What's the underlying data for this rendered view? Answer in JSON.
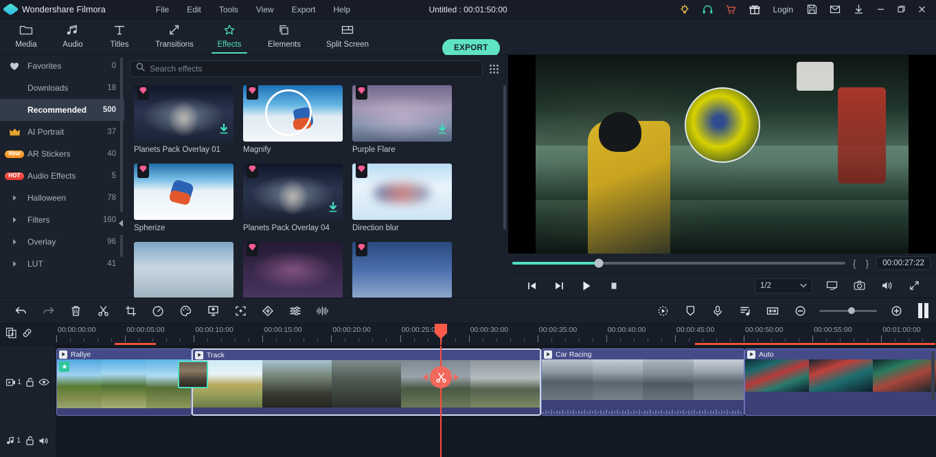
{
  "titlebar": {
    "app_name": "Wondershare Filmora",
    "logo_icon": "filmora-diamond-logo",
    "menus": [
      "File",
      "Edit",
      "Tools",
      "View",
      "Export",
      "Help"
    ],
    "project_title": "Untitled : 00:01:50:00",
    "icons": [
      {
        "name": "tips-bulb-icon",
        "glyph": "bulb",
        "color": "#f2c14e"
      },
      {
        "name": "support-headset-icon",
        "glyph": "headset",
        "color": "#3ecfb0"
      },
      {
        "name": "shopping-cart-icon",
        "glyph": "cart",
        "color": "#e05a4a"
      },
      {
        "name": "gift-icon",
        "glyph": "gift",
        "color": "#e7ebf1"
      }
    ],
    "login_label": "Login",
    "right_icons": [
      {
        "name": "save-icon",
        "glyph": "floppy"
      },
      {
        "name": "mail-icon",
        "glyph": "envelope"
      },
      {
        "name": "download-icon",
        "glyph": "download"
      }
    ],
    "window_buttons": [
      {
        "name": "minimize-button",
        "glyph": "minimize"
      },
      {
        "name": "maximize-button",
        "glyph": "maximize"
      },
      {
        "name": "close-button",
        "glyph": "close"
      }
    ]
  },
  "toolbar": {
    "tabs": [
      {
        "label": "Media",
        "icon": "folder-icon",
        "active": false
      },
      {
        "label": "Audio",
        "icon": "music-note-icon",
        "active": false
      },
      {
        "label": "Titles",
        "icon": "text-t-icon",
        "active": false
      },
      {
        "label": "Transitions",
        "icon": "transition-arrows-icon",
        "active": false
      },
      {
        "label": "Effects",
        "icon": "sparkle-star-icon",
        "active": true
      },
      {
        "label": "Elements",
        "icon": "layers-icon",
        "active": false
      },
      {
        "label": "Split Screen",
        "icon": "split-screen-icon",
        "active": false
      }
    ],
    "export_label": "EXPORT",
    "accent_color": "#4fe0c2",
    "export_bg": "#5fe3c4"
  },
  "sidebar": {
    "categories": [
      {
        "label": "Favorites",
        "count": "0",
        "icon": "heart-icon",
        "badge": null,
        "selected": false,
        "expandable": false
      },
      {
        "label": "Downloads",
        "count": "18",
        "icon": null,
        "badge": null,
        "selected": false,
        "expandable": false
      },
      {
        "label": "Recommended",
        "count": "500",
        "icon": null,
        "badge": null,
        "selected": true,
        "expandable": false
      },
      {
        "label": "AI Portrait",
        "count": "37",
        "icon": "crown-icon",
        "badge": null,
        "selected": false,
        "expandable": false
      },
      {
        "label": "AR Stickers",
        "count": "40",
        "icon": null,
        "badge": "New",
        "selected": false,
        "expandable": false
      },
      {
        "label": "Audio Effects",
        "count": "5",
        "icon": null,
        "badge": "HOT",
        "selected": false,
        "expandable": false
      },
      {
        "label": "Halloween",
        "count": "78",
        "icon": null,
        "badge": null,
        "selected": false,
        "expandable": true
      },
      {
        "label": "Filters",
        "count": "160",
        "icon": null,
        "badge": null,
        "selected": false,
        "expandable": true
      },
      {
        "label": "Overlay",
        "count": "96",
        "icon": null,
        "badge": null,
        "selected": false,
        "expandable": true
      },
      {
        "label": "LUT",
        "count": "41",
        "icon": null,
        "badge": null,
        "selected": false,
        "expandable": true
      }
    ],
    "collapse_icon": "collapse-panel-icon"
  },
  "effects": {
    "search_placeholder": "Search effects",
    "search_value": "",
    "search_icon": "search-icon",
    "grid_view_icon": "grid-view-icon",
    "items": [
      {
        "name": "Planets Pack Overlay 01",
        "premium": true,
        "download": true,
        "thumb": "th-planets"
      },
      {
        "name": "Magnify",
        "premium": true,
        "download": false,
        "thumb": "th-ski"
      },
      {
        "name": "Purple Flare",
        "premium": true,
        "download": true,
        "thumb": "th-purple"
      },
      {
        "name": "Spherize",
        "premium": true,
        "download": false,
        "thumb": "th-sphere"
      },
      {
        "name": "Planets Pack Overlay 04",
        "premium": true,
        "download": true,
        "thumb": "th-planets"
      },
      {
        "name": "Direction blur",
        "premium": true,
        "download": false,
        "thumb": "th-dblur"
      },
      {
        "name": "",
        "premium": false,
        "download": false,
        "thumb": "th-row3a"
      },
      {
        "name": "",
        "premium": true,
        "download": false,
        "thumb": "th-row3b"
      },
      {
        "name": "",
        "premium": true,
        "download": false,
        "thumb": "th-row3c"
      }
    ]
  },
  "preview": {
    "seek_percent": 26,
    "mark_in_label": "{",
    "mark_out_label": "}",
    "timecode": "00:00:27:22",
    "controls": [
      {
        "name": "prev-frame-button",
        "glyph": "prev-frame"
      },
      {
        "name": "next-frame-button",
        "glyph": "next-frame"
      },
      {
        "name": "play-button",
        "glyph": "play"
      },
      {
        "name": "stop-button",
        "glyph": "stop"
      }
    ],
    "quality_label": "1/2",
    "right_controls": [
      {
        "name": "display-mode-icon",
        "glyph": "monitor"
      },
      {
        "name": "snapshot-camera-icon",
        "glyph": "camera"
      },
      {
        "name": "volume-icon",
        "glyph": "speaker"
      },
      {
        "name": "fullscreen-icon",
        "glyph": "expand"
      }
    ]
  },
  "timeline_toolbar": {
    "left_icons": [
      {
        "name": "undo-button",
        "glyph": "undo",
        "dim": false
      },
      {
        "name": "redo-button",
        "glyph": "redo",
        "dim": true
      },
      {
        "name": "delete-button",
        "glyph": "trash",
        "dim": false
      },
      {
        "name": "split-button",
        "glyph": "scissors",
        "dim": false
      },
      {
        "name": "crop-button",
        "glyph": "crop",
        "dim": false
      },
      {
        "name": "speed-button",
        "glyph": "speedometer",
        "dim": false
      },
      {
        "name": "color-button",
        "glyph": "palette",
        "dim": false
      },
      {
        "name": "green-screen-button",
        "glyph": "green-screen",
        "dim": false
      },
      {
        "name": "auto-enhance-button",
        "glyph": "auto-frame",
        "dim": false
      },
      {
        "name": "keyframe-button",
        "glyph": "diamond-plus",
        "dim": false
      },
      {
        "name": "adjust-button",
        "glyph": "sliders",
        "dim": false
      },
      {
        "name": "audio-detach-button",
        "glyph": "waveform",
        "dim": false
      }
    ],
    "right_icons": [
      {
        "name": "motion-tracking-button",
        "glyph": "motion-track"
      },
      {
        "name": "marker-button",
        "glyph": "marker-shield"
      },
      {
        "name": "voiceover-button",
        "glyph": "microphone"
      },
      {
        "name": "audio-mixer-button",
        "glyph": "audio-mixer"
      },
      {
        "name": "fit-timeline-button",
        "glyph": "fit-width"
      },
      {
        "name": "zoom-out-button",
        "glyph": "minus-circle"
      },
      {
        "name": "zoom-in-button",
        "glyph": "plus-circle"
      },
      {
        "name": "render-preview-button",
        "glyph": "render-bars"
      }
    ],
    "zoom_percent": 56
  },
  "timeline": {
    "add_track_icon": "add-track-icon",
    "link_icon": "link-clips-icon",
    "ruler_labels": [
      "00:00:00:00",
      "00:00:05:00",
      "00:00:10:00",
      "00:00:15:00",
      "00:00:20:00",
      "00:00:25:00",
      "00:00:30:00",
      "00:00:35:00",
      "00:00:40:00",
      "00:00:45:00",
      "00:00:50:00",
      "00:00:55:00",
      "00:01:00:00"
    ],
    "playhead_time": "00:00:27:22",
    "split_handle_icon": "split-scissors-handle",
    "video_track": {
      "number": "1",
      "icons": [
        {
          "name": "video-track-icon",
          "glyph": "video"
        },
        {
          "name": "lock-track-icon",
          "glyph": "unlock"
        },
        {
          "name": "hide-track-icon",
          "glyph": "eye"
        }
      ],
      "clips": [
        {
          "title": "Rallye",
          "has_effect": true,
          "selected": false,
          "thumb": "clip-rallye"
        },
        {
          "title": "Track",
          "has_effect": true,
          "selected": true,
          "thumb": "clip-track"
        },
        {
          "title": "Car Racing",
          "has_effect": false,
          "selected": false,
          "thumb": "clip-carracing"
        },
        {
          "title": "Auto",
          "has_effect": false,
          "selected": false,
          "thumb": "clip-auto"
        }
      ]
    },
    "audio_track": {
      "number": "1",
      "icons": [
        {
          "name": "audio-track-icon",
          "glyph": "music"
        },
        {
          "name": "lock-audio-track-icon",
          "glyph": "unlock"
        },
        {
          "name": "mute-track-icon",
          "glyph": "speaker"
        }
      ]
    },
    "drag_preview_icon": "dragged-clip-thumbnail"
  }
}
